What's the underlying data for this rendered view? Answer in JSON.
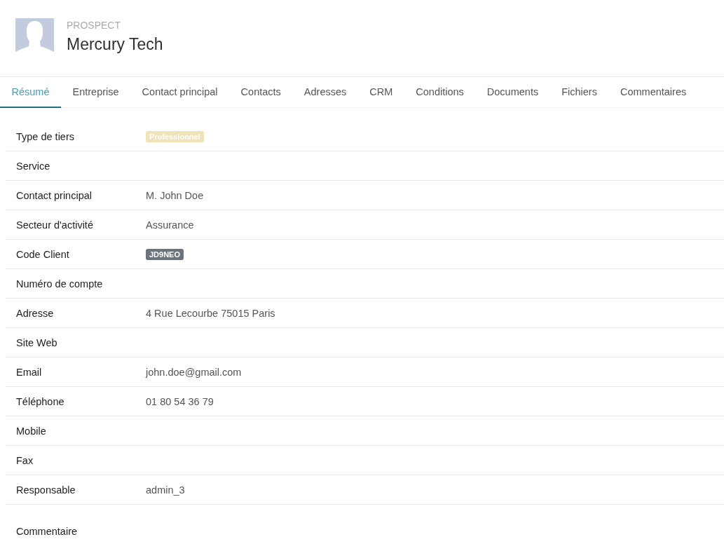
{
  "header": {
    "category": "PROSPECT",
    "title": "Mercury Tech"
  },
  "tabs": [
    {
      "label": "Résumé",
      "selected": true
    },
    {
      "label": "Entreprise",
      "selected": false
    },
    {
      "label": "Contact principal",
      "selected": false
    },
    {
      "label": "Contacts",
      "selected": false
    },
    {
      "label": "Adresses",
      "selected": false
    },
    {
      "label": "CRM",
      "selected": false
    },
    {
      "label": "Conditions",
      "selected": false
    },
    {
      "label": "Documents",
      "selected": false
    },
    {
      "label": "Fichiers",
      "selected": false
    },
    {
      "label": "Commentaires",
      "selected": false
    }
  ],
  "fields": [
    {
      "label": "Type de tiers",
      "kind": "badge",
      "value": "Professionnel",
      "color": "#f0e3b8"
    },
    {
      "label": "Service"
    },
    {
      "label": "Contact principal",
      "kind": "text",
      "value": "M. John Doe"
    },
    {
      "label": "Secteur d'activité",
      "kind": "text",
      "value": "Assurance"
    },
    {
      "label": "Code Client",
      "kind": "badge",
      "value": "JD9NEO",
      "color": "#6c737c"
    },
    {
      "label": "Numéro de compte"
    },
    {
      "label": "Adresse",
      "kind": "text",
      "value": "4 Rue Lecourbe 75015 Paris"
    },
    {
      "label": "Site Web"
    },
    {
      "label": "Email",
      "kind": "text",
      "value": "john.doe@gmail.com"
    },
    {
      "label": "Téléphone",
      "kind": "text",
      "value": "01 80 54 36 79"
    },
    {
      "label": "Mobile"
    },
    {
      "label": "Fax"
    },
    {
      "label": "Responsable",
      "kind": "text",
      "value": "admin_3"
    }
  ],
  "comment": {
    "label": "Commentaire"
  }
}
